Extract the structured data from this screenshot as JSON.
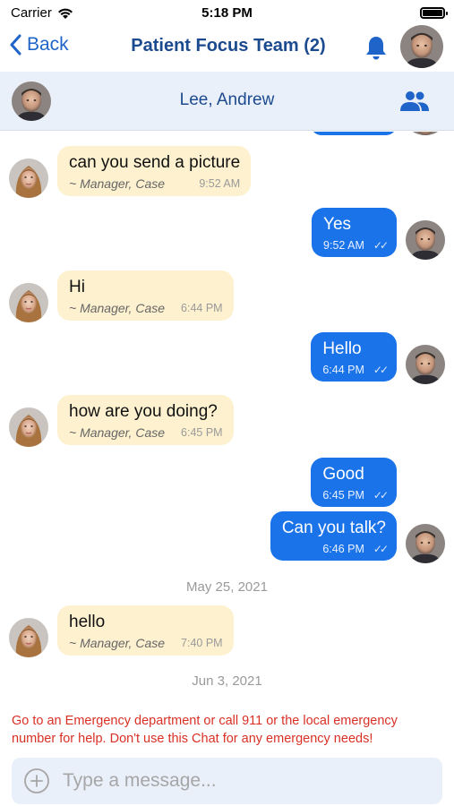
{
  "status_bar": {
    "carrier": "Carrier",
    "time": "5:18 PM"
  },
  "nav": {
    "back_label": "Back",
    "title": "Patient Focus Team (2)"
  },
  "contact": {
    "name": "Lee, Andrew"
  },
  "messages": [
    {
      "direction": "in",
      "text": "can you send a picture",
      "sender": "~ Manager, Case",
      "time": "9:52 AM"
    },
    {
      "direction": "out",
      "text": "Yes",
      "time": "9:52 AM",
      "status": "✓✓"
    },
    {
      "direction": "in",
      "text": "Hi",
      "sender": "~ Manager, Case",
      "time": "6:44 PM"
    },
    {
      "direction": "out",
      "text": "Hello",
      "time": "6:44 PM",
      "status": "✓✓"
    },
    {
      "direction": "in",
      "text": "how are you doing?",
      "sender": "~ Manager, Case",
      "time": "6:45 PM"
    },
    {
      "direction": "out",
      "text": "Good",
      "time": "6:45 PM",
      "status": "✓✓"
    },
    {
      "direction": "out",
      "text": "Can you talk?",
      "time": "6:46 PM",
      "status": "✓✓"
    },
    {
      "direction": "in",
      "text": "hello",
      "sender": "~ Manager, Case",
      "time": "7:40 PM"
    }
  ],
  "date_separators": [
    "May 25, 2021",
    "Jun 3, 2021"
  ],
  "disclaimer": "Go to an Emergency department or call 911 or the local emergency number for help. Don't use this Chat for any emergency needs!",
  "composer": {
    "placeholder": "Type a message..."
  },
  "colors": {
    "accent": "#1a73e8",
    "title": "#1c4a8f",
    "incoming_bubble": "#fdf1cf",
    "warning": "#d93025"
  }
}
